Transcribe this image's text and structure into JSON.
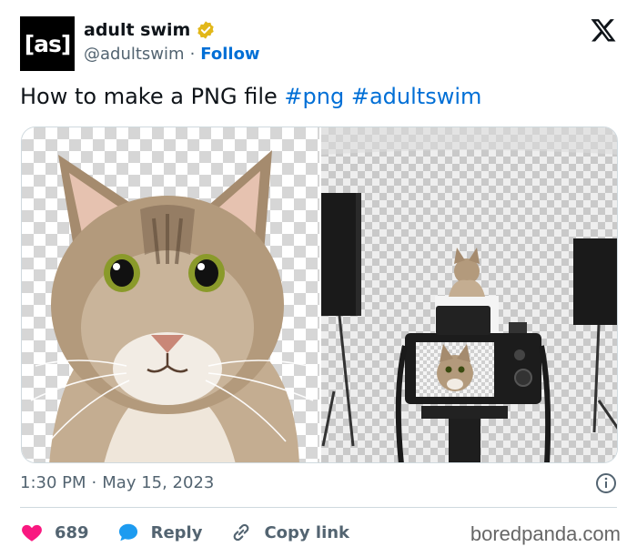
{
  "account": {
    "avatar_text": "[as]",
    "display_name": "adult swim",
    "handle": "@adultswim",
    "separator": "·",
    "follow_label": "Follow",
    "verified_color": "#e2b719"
  },
  "tweet": {
    "text_plain": "How to make a PNG file",
    "hashtags": [
      "#png",
      "#adultswim"
    ]
  },
  "media": {
    "left_description_icon": "cat-photo",
    "right_description_icon": "photo-studio-camera"
  },
  "meta": {
    "time": "1:30 PM",
    "separator": "·",
    "date": "May 15, 2023"
  },
  "actions": {
    "like_count": "689",
    "reply_label": "Reply",
    "copy_label": "Copy link"
  },
  "colors": {
    "link": "#006fd6",
    "like": "#f91880",
    "reply": "#1d9bf0",
    "muted": "#536471"
  },
  "watermark": "boredpanda.com"
}
